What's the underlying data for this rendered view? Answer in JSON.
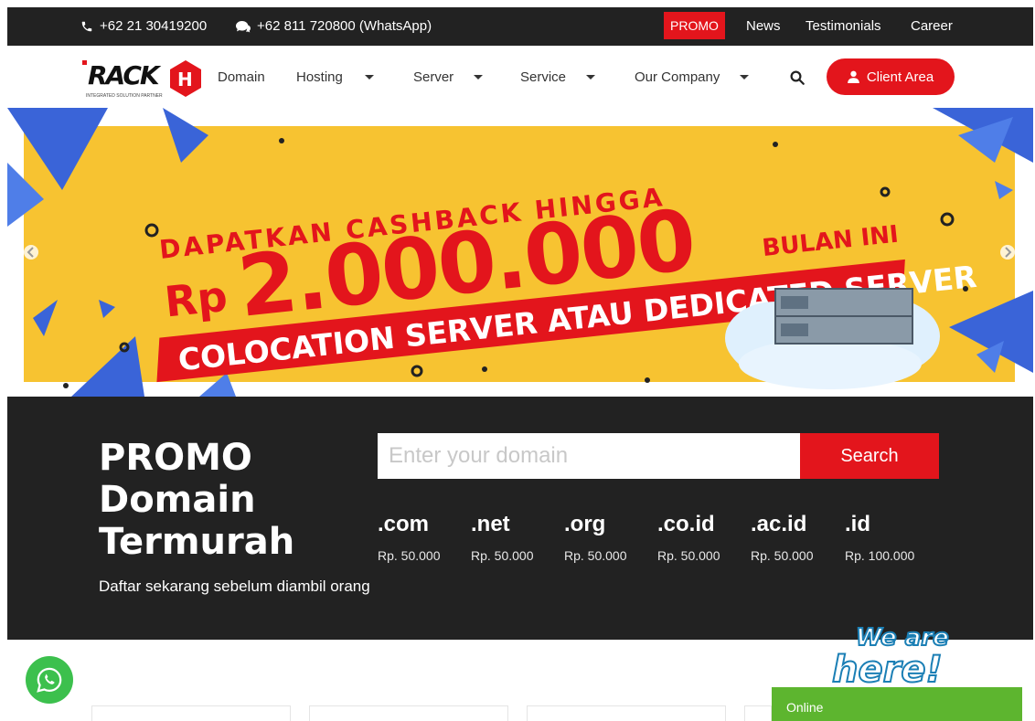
{
  "topbar": {
    "phone": "+62 21 30419200",
    "whatsapp": "+62 811 720800 (WhatsApp)",
    "promo": "PROMO",
    "links": [
      "News",
      "Testimonials",
      "Career"
    ]
  },
  "nav": {
    "logo_text": "RACK",
    "logo_tagline": "INTEGRATED SOLUTION PARTNER",
    "items": [
      {
        "label": "Domain"
      },
      {
        "label": "Hosting"
      },
      {
        "label": "Server"
      },
      {
        "label": "Service"
      },
      {
        "label": "Our Company"
      }
    ],
    "client_area": "Client Area"
  },
  "banner": {
    "line1": "DAPATKAN CASHBACK HINGGA",
    "currency": "Rp",
    "amount": "2.000.000",
    "suffix": "BULAN INI",
    "ribbon": "COLOCATION SERVER ATAU DEDICATED SERVER"
  },
  "promo": {
    "title_lines": [
      "PROMO",
      "Domain",
      "Termurah"
    ],
    "subtitle": "Daftar sekarang sebelum diambil orang",
    "search_placeholder": "Enter your domain",
    "search_button": "Search",
    "tlds": [
      {
        "ext": ".com",
        "price": "Rp. 50.000"
      },
      {
        "ext": ".net",
        "price": "Rp. 50.000"
      },
      {
        "ext": ".org",
        "price": "Rp. 50.000"
      },
      {
        "ext": ".co.id",
        "price": "Rp. 50.000"
      },
      {
        "ext": ".ac.id",
        "price": "Rp. 50.000"
      },
      {
        "ext": ".id",
        "price": "Rp. 100.000"
      }
    ]
  },
  "chat": {
    "badge_line1": "We are",
    "badge_line2": "here!",
    "status": "Online"
  },
  "colors": {
    "brand_red": "#e3151c",
    "dark": "#222222",
    "banner_yellow": "#f7c331",
    "whatsapp_green": "#3cc04d",
    "online_green": "#5db52f"
  }
}
